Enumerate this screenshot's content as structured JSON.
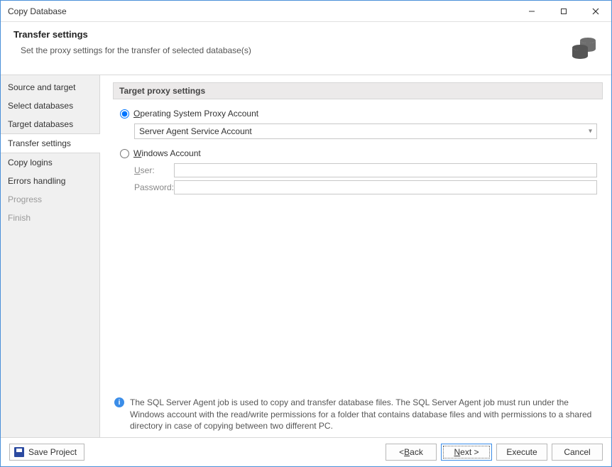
{
  "window": {
    "title": "Copy Database"
  },
  "header": {
    "title": "Transfer settings",
    "desc": "Set the proxy settings for the transfer of selected database(s)"
  },
  "sidebar": {
    "items": [
      {
        "label": "Source and target",
        "state": "done"
      },
      {
        "label": "Select databases",
        "state": "done"
      },
      {
        "label": "Target databases",
        "state": "done"
      },
      {
        "label": "Transfer settings",
        "state": "active"
      },
      {
        "label": "Copy logins",
        "state": "done"
      },
      {
        "label": "Errors handling",
        "state": "done"
      },
      {
        "label": "Progress",
        "state": "disabled"
      },
      {
        "label": "Finish",
        "state": "disabled"
      }
    ]
  },
  "panel": {
    "group_title": "Target proxy settings",
    "radio_os_prefix": "O",
    "radio_os_rest": "perating System Proxy Account",
    "dropdown_value": "Server Agent Service Account",
    "radio_win_prefix": "W",
    "radio_win_rest": "indows Account",
    "user_label_prefix": "U",
    "user_label_rest": "ser:",
    "user_value": "",
    "pass_label": "Password:",
    "pass_value": "",
    "proxy_selected": "os"
  },
  "info": {
    "text": "The SQL Server Agent job is used to copy and transfer database files. The SQL Server Agent job must run under the Windows account with the read/write permissions for a folder that contains database files and with permissions to a shared directory in case of copying between two different PC."
  },
  "footer": {
    "save_prefix": "S",
    "save_rest": "ave Project",
    "back": "< ",
    "back_u": "B",
    "back_rest": "ack",
    "next_u": "N",
    "next_rest": "ext >",
    "execute": "Execute",
    "cancel": "Cancel"
  }
}
